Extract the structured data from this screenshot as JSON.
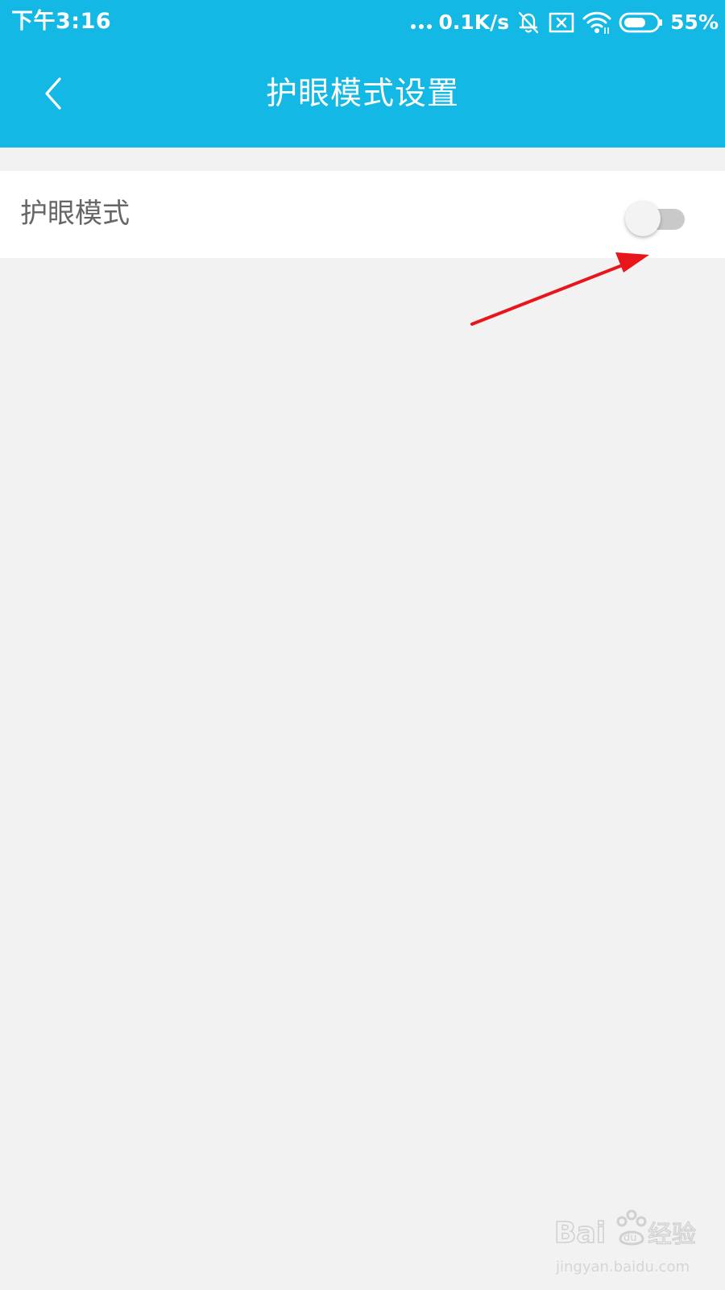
{
  "status_bar": {
    "time": "下午3:16",
    "network_speed": "0.1K/s",
    "battery_percent": "55%",
    "icons": [
      "signal-dots-icon",
      "mute-bell-icon",
      "no-sim-icon",
      "wifi-icon",
      "battery-icon"
    ]
  },
  "app_bar": {
    "title": "护眼模式设置",
    "back_icon": "chevron-left-icon"
  },
  "settings": {
    "eye_care_label": "护眼模式",
    "eye_care_enabled": false
  },
  "colors": {
    "primary": "#13b8e4",
    "background": "#f2f2f2",
    "row_background": "#ffffff",
    "label_text": "#666666",
    "annotation_arrow": "#e8161b"
  },
  "watermark": {
    "brand": "Baidu经验",
    "url": "jingyan.baidu.com"
  }
}
